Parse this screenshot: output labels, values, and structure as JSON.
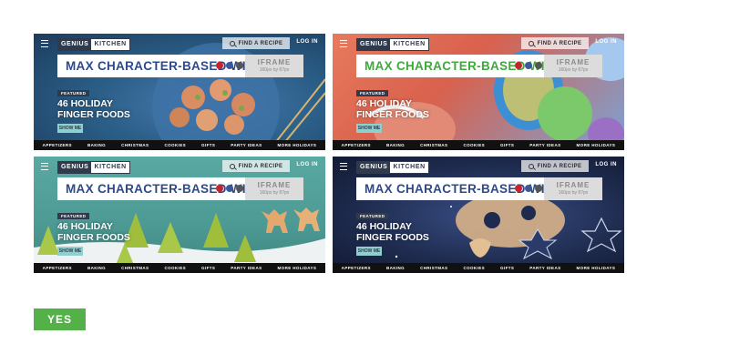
{
  "mockups": [
    {
      "title_color": "#2e4a8a",
      "background_theme": "shrimp-on-blue-plate",
      "background_color": "#2b5f88",
      "logo_left": "GENIUS",
      "logo_right": "KITCHEN",
      "find_label": "FIND A RECIPE",
      "login_label": "LOG IN",
      "ad_title": "MAX CHARACTER-BASED WID",
      "iframe_title": "IFRAME",
      "iframe_size": "160px by 87px",
      "featured_label": "FEATURED",
      "headline_line1": "46 HOLIDAY",
      "headline_line2": "FINGER FOODS",
      "show_label": "SHOW ME",
      "nav": [
        "APPETIZERS",
        "BAKING",
        "CHRISTMAS",
        "COOKIES",
        "GIFTS",
        "PARTY IDEAS",
        "MORE HOLIDAYS"
      ]
    },
    {
      "title_color": "#41a83e",
      "background_theme": "decorated-eggs",
      "background_color": "#d9614d",
      "logo_left": "GENIUS",
      "logo_right": "KITCHEN",
      "find_label": "FIND A RECIPE",
      "login_label": "LOG IN",
      "ad_title": "MAX CHARACTER-BASED WID",
      "iframe_title": "IFRAME",
      "iframe_size": "160px by 87px",
      "featured_label": "FEATURED",
      "headline_line1": "46 HOLIDAY",
      "headline_line2": "FINGER FOODS",
      "show_label": "SHOW ME",
      "nav": [
        "APPETIZERS",
        "BAKING",
        "CHRISTMAS",
        "COOKIES",
        "GIFTS",
        "PARTY IDEAS",
        "MORE HOLIDAYS"
      ]
    },
    {
      "title_color": "#2e4a8a",
      "background_theme": "tree-cookies-on-teal",
      "background_color": "#4e9b95",
      "logo_left": "GENIUS",
      "logo_right": "KITCHEN",
      "find_label": "FIND A RECIPE",
      "login_label": "LOG IN",
      "ad_title": "MAX CHARACTER-BASED WID",
      "iframe_title": "IFRAME",
      "iframe_size": "160px by 87px",
      "featured_label": "FEATURED",
      "headline_line1": "46 HOLIDAY",
      "headline_line2": "FINGER FOODS",
      "show_label": "SHOW ME",
      "nav": [
        "APPETIZERS",
        "BAKING",
        "CHRISTMAS",
        "COOKIES",
        "GIFTS",
        "PARTY IDEAS",
        "MORE HOLIDAYS"
      ]
    },
    {
      "title_color": "#2e4a8a",
      "background_theme": "cookie-dough-on-dark-blue",
      "background_color": "#1e2b4e",
      "logo_left": "GENIUS",
      "logo_right": "KITCHEN",
      "find_label": "FIND A RECIPE",
      "login_label": "LOG IN",
      "ad_title": "MAX CHARACTER-BASED WID",
      "iframe_title": "IFRAME",
      "iframe_size": "160px by 87px",
      "featured_label": "FEATURED",
      "headline_line1": "46 HOLIDAY",
      "headline_line2": "FINGER FOODS",
      "show_label": "SHOW ME",
      "nav": [
        "APPETIZERS",
        "BAKING",
        "CHRISTMAS",
        "COOKIES",
        "GIFTS",
        "PARTY IDEAS",
        "MORE HOLIDAYS"
      ]
    }
  ],
  "approval_label": "YES",
  "colors": {
    "logo_navy": "#2f3a4d",
    "show_me_teal": "#8fd0cf",
    "yes_green": "#53b147",
    "nav_black": "#111111"
  }
}
